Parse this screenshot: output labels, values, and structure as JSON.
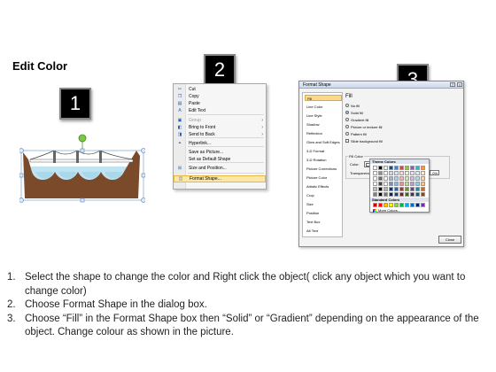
{
  "title": "Edit Color",
  "steps": [
    "1",
    "2",
    "3"
  ],
  "context_menu": {
    "items": [
      {
        "label": "Cut",
        "icon": "scissors-icon",
        "underline": "t"
      },
      {
        "label": "Copy",
        "icon": "copy-icon"
      },
      {
        "label": "Paste",
        "icon": "paste-icon"
      },
      {
        "label": "Edit Text",
        "icon": "text-icon"
      },
      {
        "label": "Group",
        "icon": "group-icon",
        "disabled": true,
        "submenu": true
      },
      {
        "label": "Bring to Front",
        "icon": "bring-front-icon",
        "submenu": true
      },
      {
        "label": "Send to Back",
        "icon": "send-back-icon",
        "submenu": true
      },
      {
        "label": "Hyperlink...",
        "icon": "hyperlink-icon"
      },
      {
        "label": "Save as Picture...",
        "icon": ""
      },
      {
        "label": "Set as Default Shape",
        "icon": ""
      },
      {
        "label": "Size and Position...",
        "icon": "size-position-icon"
      },
      {
        "label": "Format Shape...",
        "icon": "format-shape-icon",
        "highlighted": true
      }
    ]
  },
  "format_dialog": {
    "title": "Format Shape",
    "categories": [
      "Fill",
      "Line Color",
      "Line Style",
      "Shadow",
      "Reflection",
      "Glow and Soft Edges",
      "3-D Format",
      "3-D Rotation",
      "Picture Corrections",
      "Picture Color",
      "Artistic Effects",
      "Crop",
      "Size",
      "Position",
      "Text Box",
      "Alt Text"
    ],
    "selected_category": "Fill",
    "section_title": "Fill",
    "options": [
      "No fill",
      "Solid fill",
      "Gradient fill",
      "Picture or texture fill",
      "Pattern fill",
      "Slide background fill"
    ],
    "selected_option": "Solid fill",
    "fill_color_group": "Fill Color",
    "color_label": "Color:",
    "transparency_label": "Transparency:",
    "transparency_value": "0%",
    "close_label": "Close"
  },
  "palette": {
    "theme_header": "Theme Colors",
    "standard_header": "Standard Colors",
    "more_label": "More Colors...",
    "theme_base": [
      "#ffffff",
      "#000000",
      "#eeece1",
      "#1f497d",
      "#4f81bd",
      "#c0504d",
      "#9bbb59",
      "#8064a2",
      "#4bacc6",
      "#f79646"
    ],
    "standard": [
      "#c00000",
      "#ff0000",
      "#ffc000",
      "#ffff00",
      "#92d050",
      "#00b050",
      "#00b0f0",
      "#0070c0",
      "#002060",
      "#7030a0"
    ]
  },
  "instructions": [
    {
      "num": "1.",
      "text": "Select the shape to change the color and Right click the object( click any object which you want to change color)"
    },
    {
      "num": "2.",
      "text": "Choose Format Shape in the dialog box."
    },
    {
      "num": "3.",
      "text": "Choose “Fill” in the Format Shape box then “Solid” or “Gradient” depending on the appearance of the object. Change colour as shown in the picture."
    }
  ]
}
